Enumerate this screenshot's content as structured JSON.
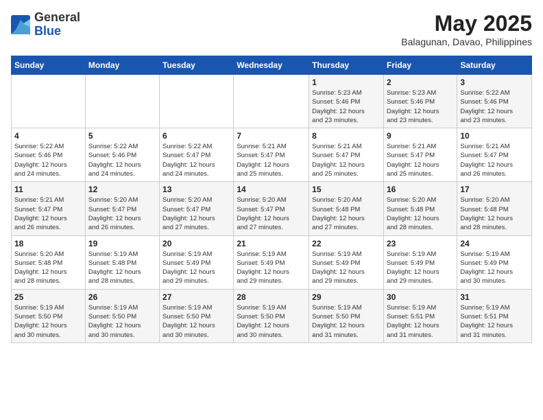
{
  "header": {
    "logo_general": "General",
    "logo_blue": "Blue",
    "month": "May 2025",
    "location": "Balagunan, Davao, Philippines"
  },
  "weekdays": [
    "Sunday",
    "Monday",
    "Tuesday",
    "Wednesday",
    "Thursday",
    "Friday",
    "Saturday"
  ],
  "weeks": [
    [
      {
        "day": "",
        "info": ""
      },
      {
        "day": "",
        "info": ""
      },
      {
        "day": "",
        "info": ""
      },
      {
        "day": "",
        "info": ""
      },
      {
        "day": "1",
        "info": "Sunrise: 5:23 AM\nSunset: 5:46 PM\nDaylight: 12 hours\nand 23 minutes."
      },
      {
        "day": "2",
        "info": "Sunrise: 5:23 AM\nSunset: 5:46 PM\nDaylight: 12 hours\nand 23 minutes."
      },
      {
        "day": "3",
        "info": "Sunrise: 5:22 AM\nSunset: 5:46 PM\nDaylight: 12 hours\nand 23 minutes."
      }
    ],
    [
      {
        "day": "4",
        "info": "Sunrise: 5:22 AM\nSunset: 5:46 PM\nDaylight: 12 hours\nand 24 minutes."
      },
      {
        "day": "5",
        "info": "Sunrise: 5:22 AM\nSunset: 5:46 PM\nDaylight: 12 hours\nand 24 minutes."
      },
      {
        "day": "6",
        "info": "Sunrise: 5:22 AM\nSunset: 5:47 PM\nDaylight: 12 hours\nand 24 minutes."
      },
      {
        "day": "7",
        "info": "Sunrise: 5:21 AM\nSunset: 5:47 PM\nDaylight: 12 hours\nand 25 minutes."
      },
      {
        "day": "8",
        "info": "Sunrise: 5:21 AM\nSunset: 5:47 PM\nDaylight: 12 hours\nand 25 minutes."
      },
      {
        "day": "9",
        "info": "Sunrise: 5:21 AM\nSunset: 5:47 PM\nDaylight: 12 hours\nand 25 minutes."
      },
      {
        "day": "10",
        "info": "Sunrise: 5:21 AM\nSunset: 5:47 PM\nDaylight: 12 hours\nand 26 minutes."
      }
    ],
    [
      {
        "day": "11",
        "info": "Sunrise: 5:21 AM\nSunset: 5:47 PM\nDaylight: 12 hours\nand 26 minutes."
      },
      {
        "day": "12",
        "info": "Sunrise: 5:20 AM\nSunset: 5:47 PM\nDaylight: 12 hours\nand 26 minutes."
      },
      {
        "day": "13",
        "info": "Sunrise: 5:20 AM\nSunset: 5:47 PM\nDaylight: 12 hours\nand 27 minutes."
      },
      {
        "day": "14",
        "info": "Sunrise: 5:20 AM\nSunset: 5:47 PM\nDaylight: 12 hours\nand 27 minutes."
      },
      {
        "day": "15",
        "info": "Sunrise: 5:20 AM\nSunset: 5:48 PM\nDaylight: 12 hours\nand 27 minutes."
      },
      {
        "day": "16",
        "info": "Sunrise: 5:20 AM\nSunset: 5:48 PM\nDaylight: 12 hours\nand 28 minutes."
      },
      {
        "day": "17",
        "info": "Sunrise: 5:20 AM\nSunset: 5:48 PM\nDaylight: 12 hours\nand 28 minutes."
      }
    ],
    [
      {
        "day": "18",
        "info": "Sunrise: 5:20 AM\nSunset: 5:48 PM\nDaylight: 12 hours\nand 28 minutes."
      },
      {
        "day": "19",
        "info": "Sunrise: 5:19 AM\nSunset: 5:48 PM\nDaylight: 12 hours\nand 28 minutes."
      },
      {
        "day": "20",
        "info": "Sunrise: 5:19 AM\nSunset: 5:49 PM\nDaylight: 12 hours\nand 29 minutes."
      },
      {
        "day": "21",
        "info": "Sunrise: 5:19 AM\nSunset: 5:49 PM\nDaylight: 12 hours\nand 29 minutes."
      },
      {
        "day": "22",
        "info": "Sunrise: 5:19 AM\nSunset: 5:49 PM\nDaylight: 12 hours\nand 29 minutes."
      },
      {
        "day": "23",
        "info": "Sunrise: 5:19 AM\nSunset: 5:49 PM\nDaylight: 12 hours\nand 29 minutes."
      },
      {
        "day": "24",
        "info": "Sunrise: 5:19 AM\nSunset: 5:49 PM\nDaylight: 12 hours\nand 30 minutes."
      }
    ],
    [
      {
        "day": "25",
        "info": "Sunrise: 5:19 AM\nSunset: 5:50 PM\nDaylight: 12 hours\nand 30 minutes."
      },
      {
        "day": "26",
        "info": "Sunrise: 5:19 AM\nSunset: 5:50 PM\nDaylight: 12 hours\nand 30 minutes."
      },
      {
        "day": "27",
        "info": "Sunrise: 5:19 AM\nSunset: 5:50 PM\nDaylight: 12 hours\nand 30 minutes."
      },
      {
        "day": "28",
        "info": "Sunrise: 5:19 AM\nSunset: 5:50 PM\nDaylight: 12 hours\nand 30 minutes."
      },
      {
        "day": "29",
        "info": "Sunrise: 5:19 AM\nSunset: 5:50 PM\nDaylight: 12 hours\nand 31 minutes."
      },
      {
        "day": "30",
        "info": "Sunrise: 5:19 AM\nSunset: 5:51 PM\nDaylight: 12 hours\nand 31 minutes."
      },
      {
        "day": "31",
        "info": "Sunrise: 5:19 AM\nSunset: 5:51 PM\nDaylight: 12 hours\nand 31 minutes."
      }
    ]
  ]
}
